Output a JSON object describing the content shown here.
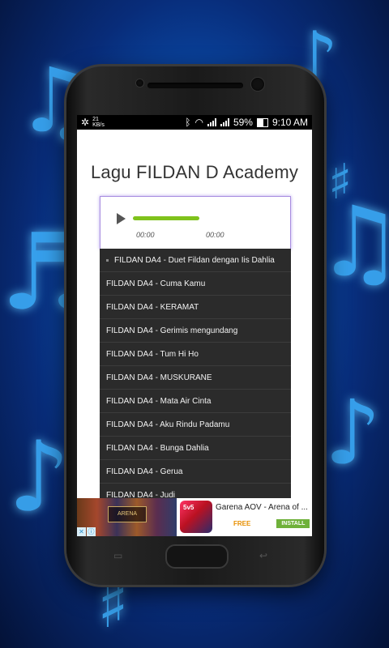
{
  "status_bar": {
    "speed_value": "21",
    "speed_unit": "KB/s",
    "battery": "59%",
    "time": "9:10 AM"
  },
  "app": {
    "title": "Lagu FILDAN D Academy"
  },
  "player": {
    "current_time": "00:00",
    "duration": "00:00",
    "progress": 1.0
  },
  "playlist": [
    "FILDAN DA4 - Duet Fildan dengan Iis Dahlia",
    "FILDAN DA4 - Cuma Kamu",
    "FILDAN DA4 - KERAMAT",
    "FILDAN DA4 - Gerimis mengundang",
    "FILDAN DA4 - Tum Hi Ho",
    "FILDAN DA4 - MUSKURANE",
    "FILDAN DA4 - Mata Air Cinta",
    "FILDAN DA4 - Aku Rindu Padamu",
    "FILDAN DA4 - Bunga Dahlia",
    "FILDAN DA4 - Gerua",
    "FILDAN DA4 - Judi"
  ],
  "ad": {
    "banner_logo": "ARENA",
    "app_icon_text": "5v5",
    "app_title": "Garena AOV - Arena of ...",
    "price": "FREE",
    "install_label": "INSTALL"
  },
  "colors": {
    "progress": "#7fc21c",
    "list_bg": "#2b2b2b",
    "player_border": "#a88de0",
    "background": "#0b55b8"
  }
}
